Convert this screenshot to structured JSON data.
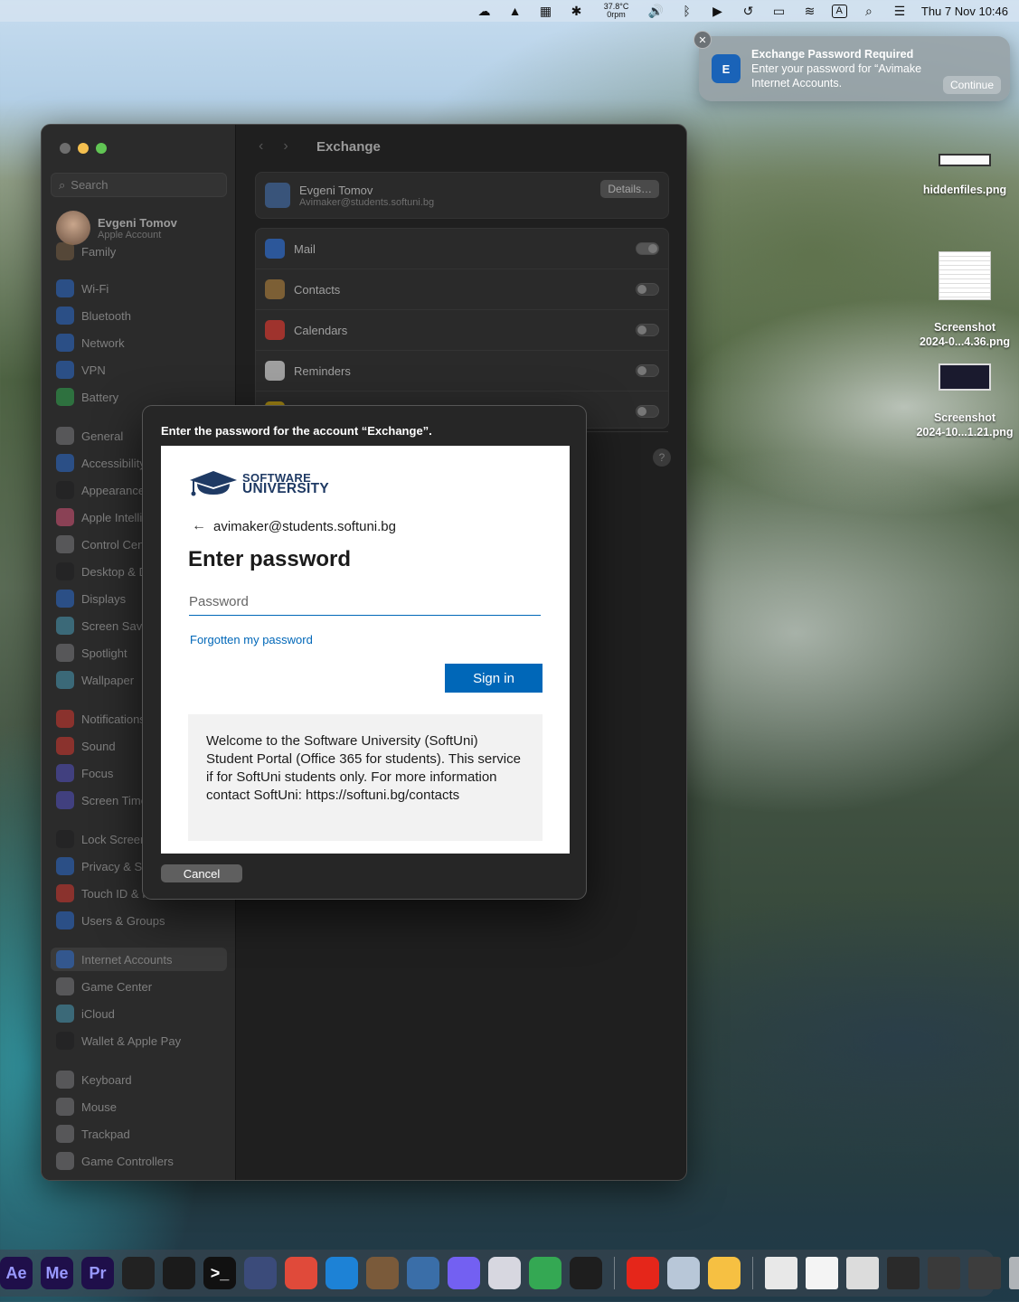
{
  "menubar": {
    "temp_top": "37.8°C",
    "temp_bottom": "0rpm",
    "input_source": "A",
    "clock": "Thu 7 Nov  10:46"
  },
  "notification": {
    "title": "Exchange Password Required",
    "body_line1": "Enter your password for “Avimake",
    "body_line2": "Internet Accounts.",
    "button": "Continue",
    "close": "✕"
  },
  "desktop": {
    "items": [
      {
        "label": "hiddenfiles.png"
      },
      {
        "label": "Screenshot\n2024-0...4.36.png"
      },
      {
        "label": "Screenshot\n2024-10...1.21.png"
      }
    ]
  },
  "settings": {
    "search_placeholder": "Search",
    "profile_name": "Evgeni Tomov",
    "profile_sub": "Apple Account",
    "sidebar": [
      {
        "label": "Family",
        "color": "#8a6a4a"
      },
      {
        "label": "Wi-Fi",
        "color": "#2d7cf6"
      },
      {
        "label": "Bluetooth",
        "color": "#2d7cf6"
      },
      {
        "label": "Network",
        "color": "#2d7cf6"
      },
      {
        "label": "VPN",
        "color": "#2d7cf6"
      },
      {
        "label": "Battery",
        "color": "#34c759"
      },
      {
        "label": "General",
        "color": "#8e8e93"
      },
      {
        "label": "Accessibility",
        "color": "#2d7cf6"
      },
      {
        "label": "Appearance",
        "color": "#1c1c1e"
      },
      {
        "label": "Apple Intelligence",
        "color": "#ff5e8a"
      },
      {
        "label": "Control Centre",
        "color": "#8e8e93"
      },
      {
        "label": "Desktop & Dock",
        "color": "#1c1c1e"
      },
      {
        "label": "Displays",
        "color": "#2d7cf6"
      },
      {
        "label": "Screen Saver",
        "color": "#4fb5d8"
      },
      {
        "label": "Spotlight",
        "color": "#8e8e93"
      },
      {
        "label": "Wallpaper",
        "color": "#4fb5d8"
      },
      {
        "label": "Notifications",
        "color": "#ff3b30"
      },
      {
        "label": "Sound",
        "color": "#ff3b30"
      },
      {
        "label": "Focus",
        "color": "#5e5ce6"
      },
      {
        "label": "Screen Time",
        "color": "#5e5ce6"
      },
      {
        "label": "Lock Screen",
        "color": "#1c1c1e"
      },
      {
        "label": "Privacy & Security",
        "color": "#2d7cf6"
      },
      {
        "label": "Touch ID & Password",
        "color": "#ff3b30"
      },
      {
        "label": "Users & Groups",
        "color": "#2d7cf6"
      },
      {
        "label": "Internet Accounts",
        "color": "#2d7cf6"
      },
      {
        "label": "Game Center",
        "color": "#8e8e93"
      },
      {
        "label": "iCloud",
        "color": "#4fb5d8"
      },
      {
        "label": "Wallet & Apple Pay",
        "color": "#1c1c1e"
      },
      {
        "label": "Keyboard",
        "color": "#8e8e93"
      },
      {
        "label": "Mouse",
        "color": "#8e8e93"
      },
      {
        "label": "Trackpad",
        "color": "#8e8e93"
      },
      {
        "label": "Game Controllers",
        "color": "#8e8e93"
      }
    ],
    "title": "Exchange",
    "account_name": "Evgeni Tomov",
    "account_email": "Avimaker@students.softuni.bg",
    "details_button": "Details…",
    "services": [
      {
        "label": "Mail",
        "on": true,
        "color": "#2d7cf6"
      },
      {
        "label": "Contacts",
        "on": false,
        "color": "#c08a3e"
      },
      {
        "label": "Calendars",
        "on": false,
        "color": "#ff3b30"
      },
      {
        "label": "Reminders",
        "on": false,
        "color": "#ffffff"
      },
      {
        "label": "",
        "on": false,
        "color": "#ffcc00"
      }
    ],
    "help": "?"
  },
  "dialog": {
    "prompt": "Enter the password for the account “Exchange”.",
    "logo_line1": "SOFTWARE",
    "logo_line2": "UNIVERSITY",
    "email": "avimaker@students.softuni.bg",
    "heading": "Enter password",
    "password_placeholder": "Password",
    "forgot_link": "Forgotten my password",
    "signin_button": "Sign in",
    "welcome_text": "Welcome to the Software University (SoftUni) Student Portal (Office 365 for students). This service if for SoftUni students only. For more information contact SoftUni: https://softuni.bg/contacts",
    "cancel_button": "Cancel"
  },
  "dock": {
    "apps": [
      {
        "label": "Ae",
        "color": "#1f0f4a",
        "text": "#9999ff"
      },
      {
        "label": "Me",
        "color": "#1f0f4a",
        "text": "#9999ff"
      },
      {
        "label": "Pr",
        "color": "#1f0f4a",
        "text": "#9999ff"
      },
      {
        "label": "",
        "color": "#222222",
        "text": "#37d36a"
      },
      {
        "label": "",
        "color": "#1b1b1b",
        "text": "#37d36a"
      },
      {
        "label": ">_",
        "color": "#111111",
        "text": "#ffffff"
      },
      {
        "label": "",
        "color": "#3b4b7a",
        "text": "#ffffff"
      },
      {
        "label": "",
        "color": "#e04a3a",
        "text": "#ffffff"
      },
      {
        "label": "",
        "color": "#1d82d6",
        "text": "#ffffff"
      },
      {
        "label": "",
        "color": "#7a5a3a",
        "text": "#ffffff"
      },
      {
        "label": "",
        "color": "#3a6ea8",
        "text": "#ffffff"
      },
      {
        "label": "",
        "color": "#7360f2",
        "text": "#ffffff"
      },
      {
        "label": "",
        "color": "#d7d7e0",
        "text": "#333333"
      },
      {
        "label": "",
        "color": "#34a853",
        "text": "#ffffff"
      },
      {
        "label": "",
        "color": "#1e1e1e",
        "text": "#ffffff"
      },
      {
        "label": "",
        "color": "#e5261a",
        "text": "#ffffff"
      },
      {
        "label": "",
        "color": "#b8c7d8",
        "text": "#333333"
      },
      {
        "label": "",
        "color": "#f6c042",
        "text": "#ffffff"
      }
    ],
    "docs": [
      {
        "color": "#e8e8e8"
      },
      {
        "color": "#f4f4f4"
      },
      {
        "color": "#dcdcdc"
      },
      {
        "color": "#2a2a2a"
      },
      {
        "color": "#3a3a3a"
      },
      {
        "color": "#3d3d3d"
      },
      {
        "color": "#b0b4b8"
      }
    ]
  }
}
